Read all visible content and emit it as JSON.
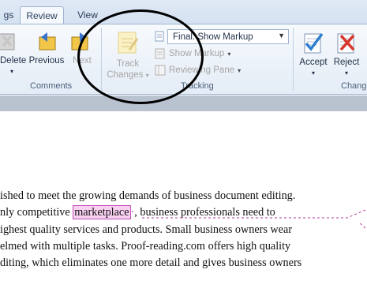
{
  "tabs": [
    {
      "label": "gs"
    },
    {
      "label": "Review"
    },
    {
      "label": "View"
    }
  ],
  "ribbon": {
    "comments": {
      "delete_label": "Delete",
      "previous_label": "Previous",
      "next_label": "Next",
      "group_label": "Comments"
    },
    "tracking": {
      "track_changes_label1": "Track",
      "track_changes_label2": "Changes",
      "markup_select": "Final: Show Markup",
      "show_markup_label": "Show Markup",
      "reviewing_pane_label": "Reviewing Pane",
      "group_label": "Tracking"
    },
    "changes": {
      "accept_label": "Accept",
      "reject_label": "Reject",
      "group_label": "Chang"
    }
  },
  "document": {
    "line1": "ished to meet the growing demands of business document editing.",
    "line2_pre": "nly competitive ",
    "line2_highlight": "marketplace",
    "line2_post": ", business professionals need to",
    "line3": "ighest quality services and products. Small business owners wear",
    "line4": "elmed with multiple tasks. Proof-reading.com offers high quality",
    "line5": "diting, which eliminates one more detail and gives business owners"
  },
  "colors": {
    "track_change": "#b03aa8",
    "highlight": "#f8d0f0"
  }
}
